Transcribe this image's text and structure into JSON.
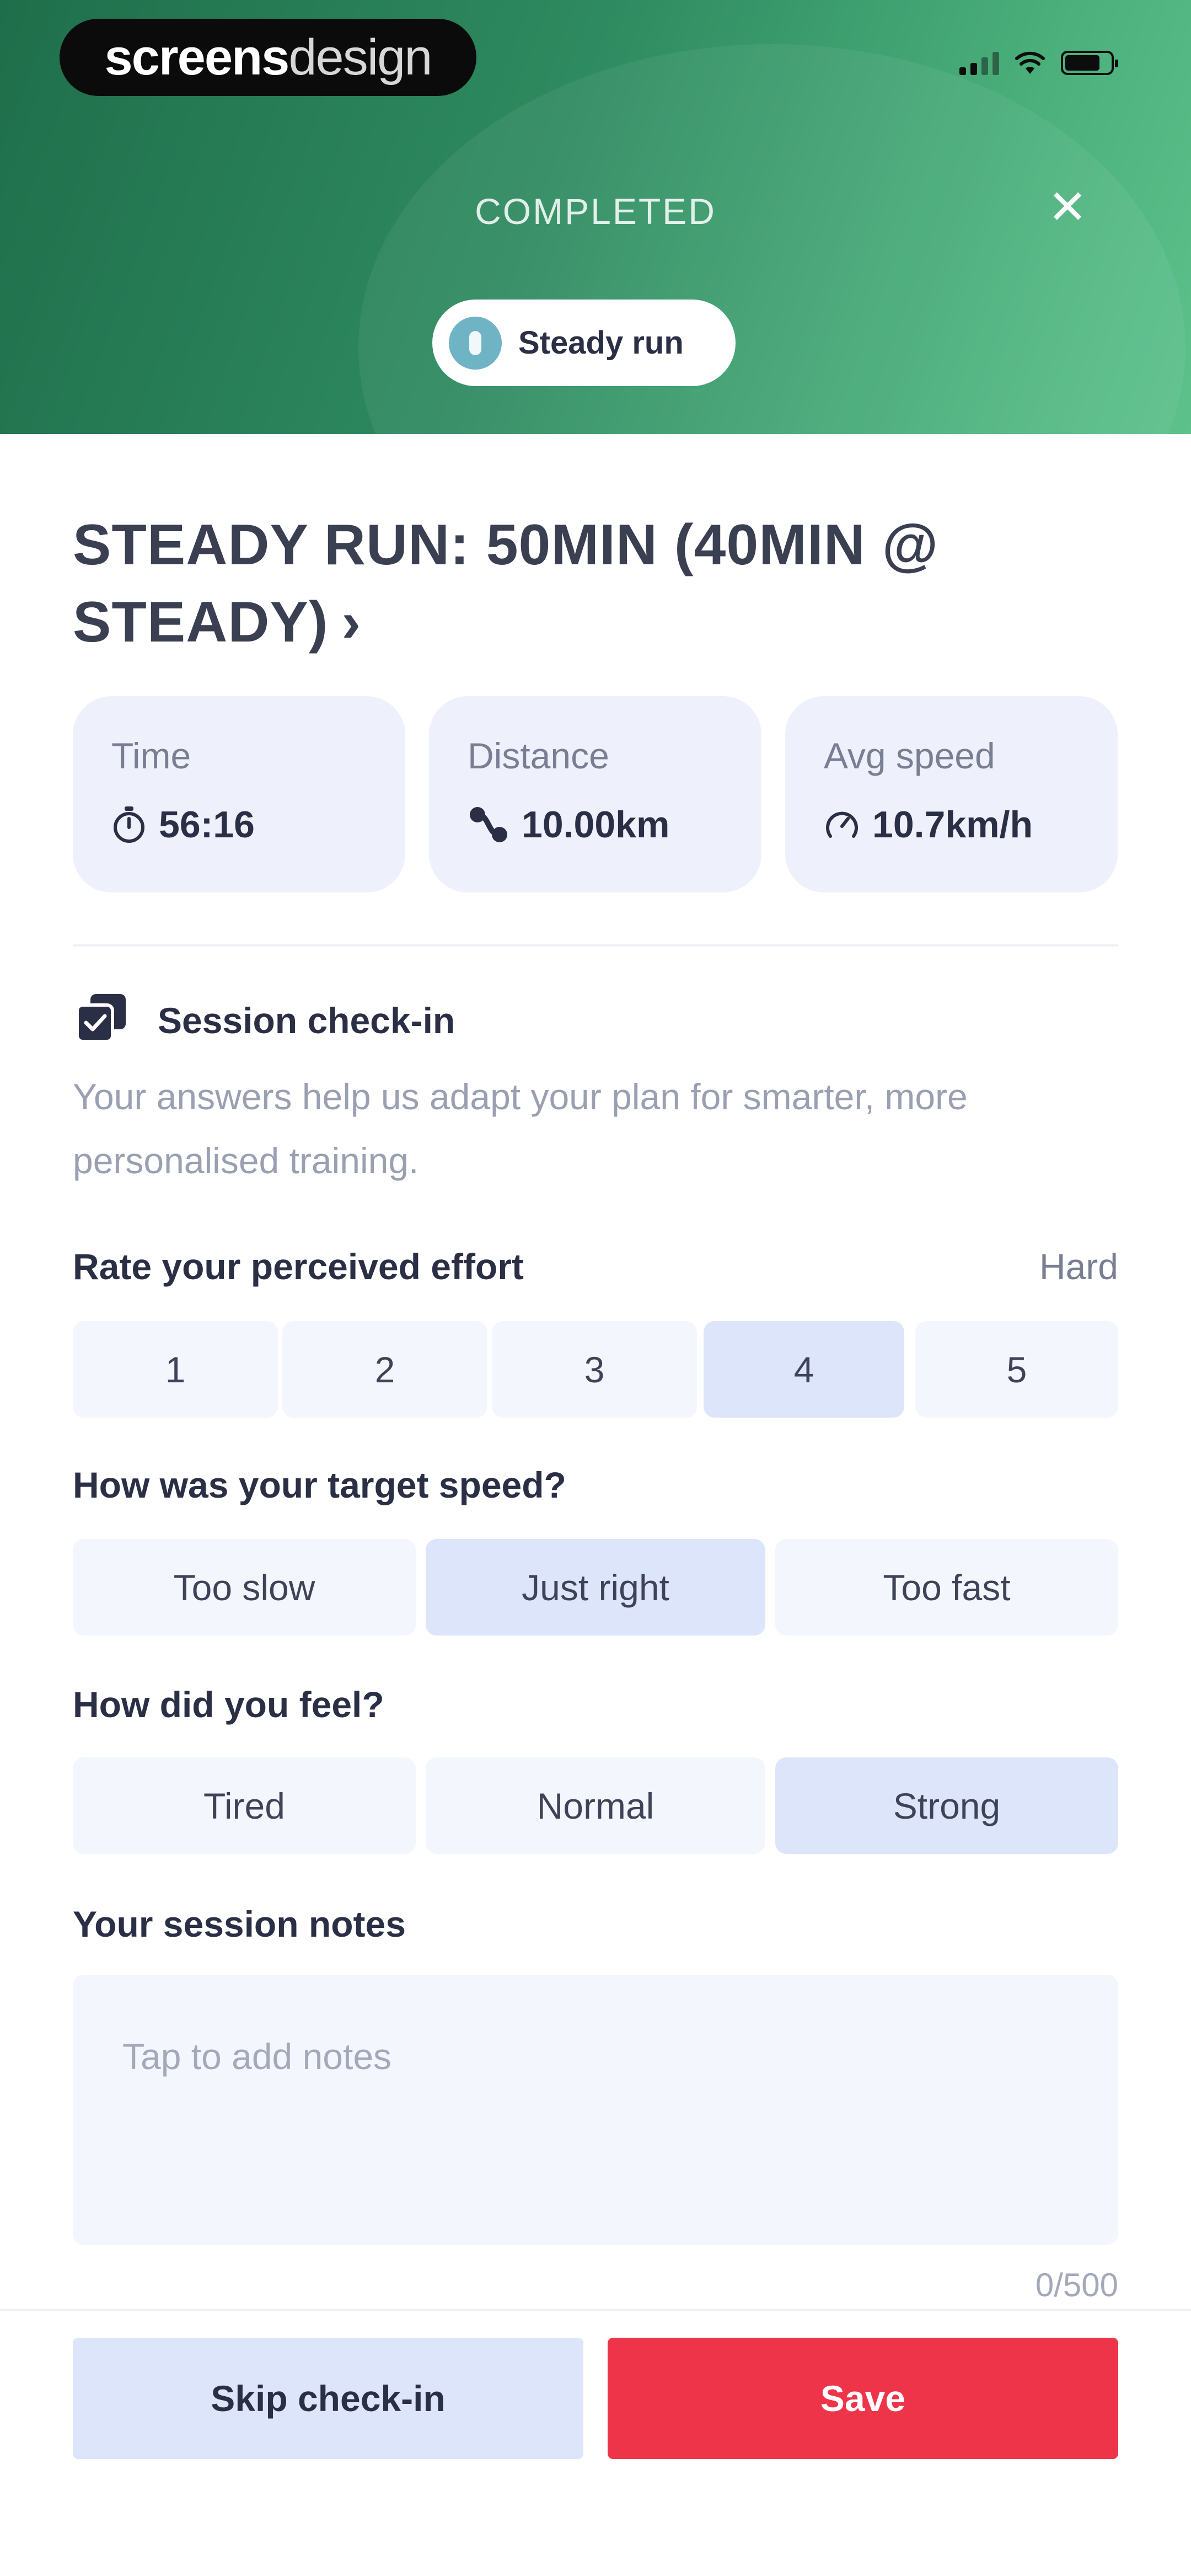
{
  "status_bar": {
    "logo_primary": "screens",
    "logo_secondary": "design"
  },
  "header": {
    "title": "COMPLETED",
    "close_symbol": "✕",
    "badge_label": "Steady run"
  },
  "session": {
    "title": "STEADY RUN: 50MIN (40MIN @ STEADY)",
    "chevron": "›"
  },
  "stats": [
    {
      "label": "Time",
      "value": "56:16",
      "icon": "stopwatch-icon"
    },
    {
      "label": "Distance",
      "value": "10.00km",
      "icon": "route-icon"
    },
    {
      "label": "Avg speed",
      "value": "10.7km/h",
      "icon": "speedometer-icon"
    }
  ],
  "checkin": {
    "title": "Session check-in",
    "description": "Your answers help us adapt your plan for smarter, more personalised training."
  },
  "effort": {
    "label": "Rate your perceived effort",
    "selected_text": "Hard",
    "options": [
      "1",
      "2",
      "3",
      "4",
      "5"
    ],
    "selected_index": 3
  },
  "speed": {
    "label": "How was your target speed?",
    "options": [
      "Too slow",
      "Just right",
      "Too fast"
    ],
    "selected_index": 1
  },
  "feel": {
    "label": "How did you feel?",
    "options": [
      "Tired",
      "Normal",
      "Strong"
    ],
    "selected_index": 2
  },
  "notes": {
    "label": "Your session notes",
    "placeholder": "Tap to add notes",
    "char_count": "0/500"
  },
  "actions": {
    "skip_label": "Skip check-in",
    "save_label": "Save"
  },
  "colors": {
    "header_gradient_start": "#1f6e4b",
    "header_gradient_end": "#5cc18b",
    "selected_option": "#dde5fb",
    "save_button": "#ee3449"
  }
}
